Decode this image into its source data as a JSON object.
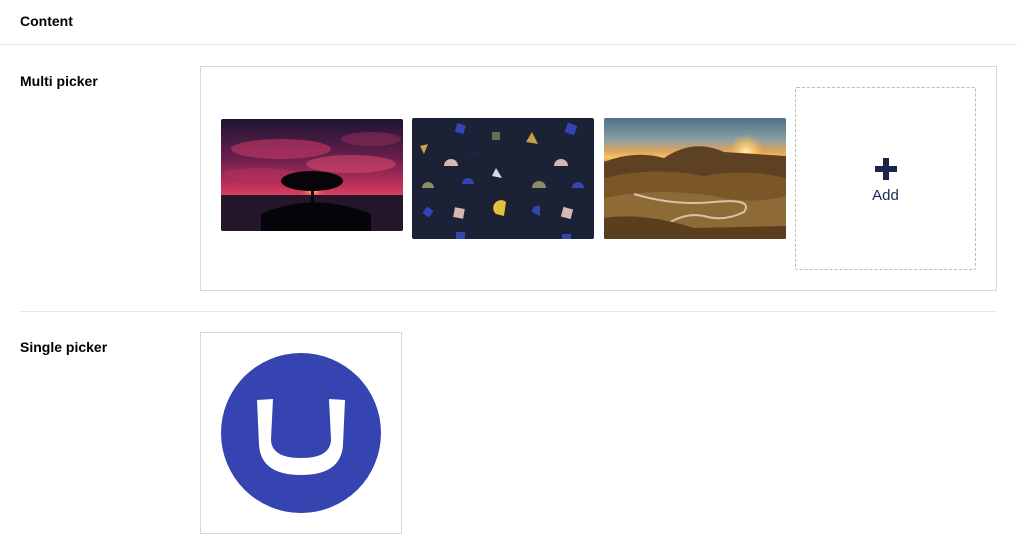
{
  "header": {
    "title": "Content"
  },
  "multi_picker": {
    "label": "Multi picker",
    "items": [
      {
        "name": "tree-sunset-image"
      },
      {
        "name": "geometric-pattern-image"
      },
      {
        "name": "hills-sunset-road-image"
      }
    ],
    "add_label": "Add"
  },
  "single_picker": {
    "label": "Single picker",
    "item": {
      "name": "umbraco-logo-image"
    }
  },
  "colors": {
    "accent": "#1b264f",
    "logo_blue": "#3544b1",
    "border": "#d8d7d9",
    "divider": "#e9e9eb"
  }
}
